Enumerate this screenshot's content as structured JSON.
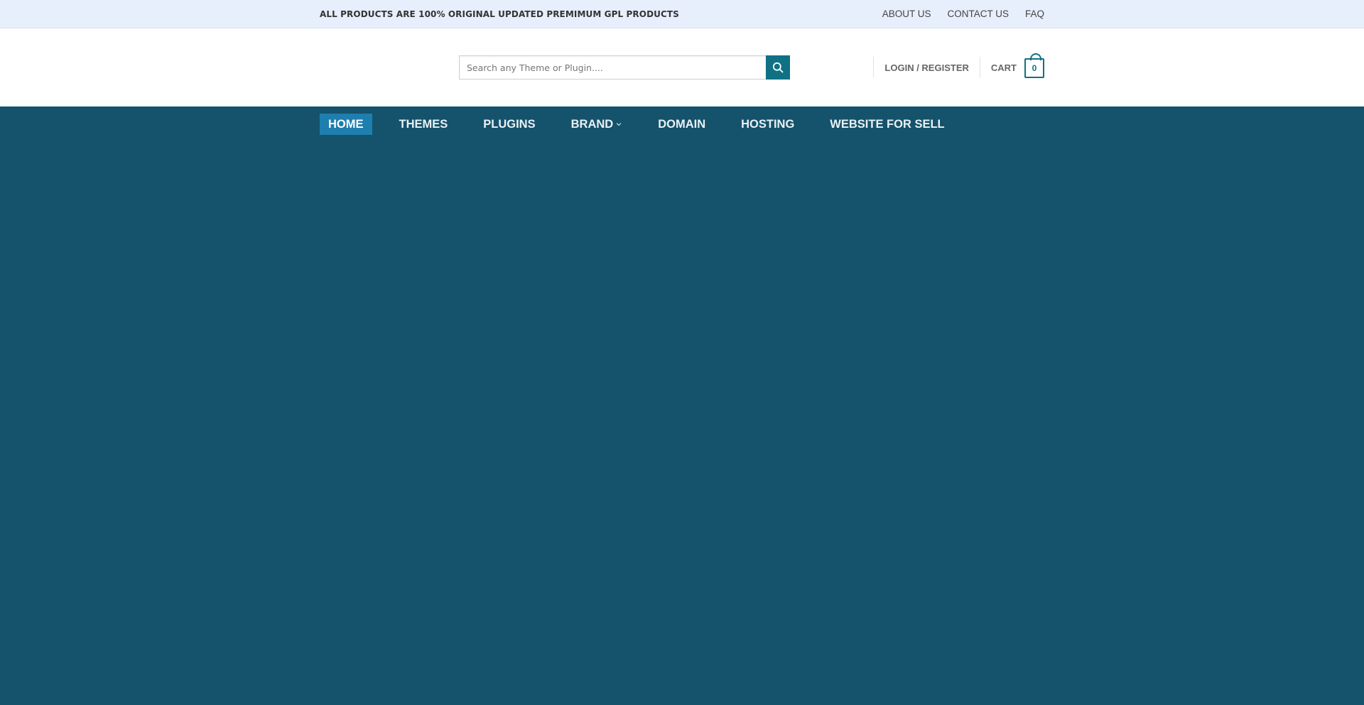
{
  "top_bar": {
    "notice": "ALL PRODUCTS ARE 100% ORIGINAL UPDATED PREMIMUM GPL PRODUCTS",
    "links": [
      "ABOUT US",
      "CONTACT US",
      "FAQ"
    ]
  },
  "header": {
    "search": {
      "placeholder": "Search any Theme or Plugin....",
      "value": ""
    },
    "search_icon": "search-icon",
    "login_label": "LOGIN / REGISTER",
    "cart": {
      "label": "CART",
      "count": "0"
    }
  },
  "nav": {
    "items": [
      {
        "label": "HOME",
        "active": true
      },
      {
        "label": "THEMES"
      },
      {
        "label": "PLUGINS"
      },
      {
        "label": "BRAND",
        "has_dropdown": true
      },
      {
        "label": "DOMAIN"
      },
      {
        "label": "HOSTING"
      },
      {
        "label": "WEBSITE FOR SELL"
      }
    ]
  },
  "colors": {
    "top_bar_bg": "#e7eefc",
    "header_bg": "#ffffff",
    "nav_bg": "#15526b",
    "active_nav_bg": "#1e7fae",
    "accent": "#0f7183"
  }
}
